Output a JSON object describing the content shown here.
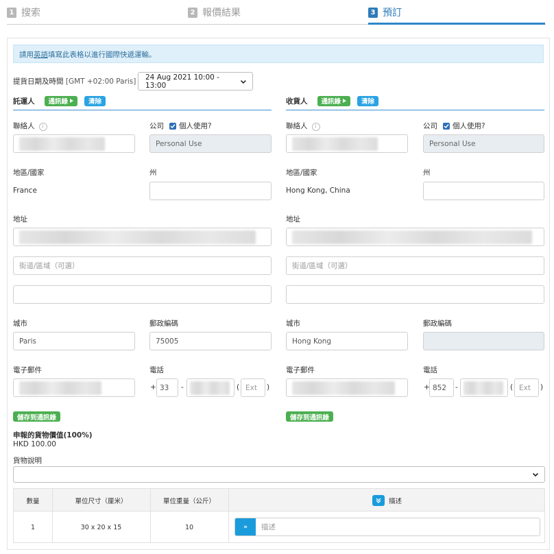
{
  "steps": [
    {
      "num": "1",
      "label": "搜索"
    },
    {
      "num": "2",
      "label": "報價結果"
    },
    {
      "num": "3",
      "label": "預訂"
    }
  ],
  "notice": {
    "prefix": "請用",
    "link": "英語",
    "suffix": "填寫此表格以進行國際快遞運輸。"
  },
  "pickup": {
    "label": "提貨日期及時間",
    "tz": "[GMT +02:00 Paris]",
    "value": "24 Aug 2021 10:00 - 13:00"
  },
  "shipper": {
    "title": "託運人",
    "address_book": "通訊錄",
    "clear": "清除",
    "contact_label": "聯絡人",
    "company_label": "公司",
    "personal_use_label": "個人使用?",
    "company_value": "Personal Use",
    "region_label": "地區/國家",
    "region_value": "France",
    "state_label": "州",
    "address_label": "地址",
    "street_placeholder": "街道/區域（可選）",
    "city_label": "城市",
    "city_value": "Paris",
    "postal_label": "郵政編碼",
    "postal_value": "75005",
    "email_label": "電子郵件",
    "phone_label": "電話",
    "phone_plus": "+",
    "phone_code": "33",
    "phone_dash": "-",
    "ext_open": "(",
    "ext_placeholder": "Ext",
    "ext_close": ")",
    "save_contact": "儲存到通訊錄"
  },
  "consignee": {
    "title": "收貨人",
    "address_book": "通訊錄",
    "clear": "清除",
    "contact_label": "聯絡人",
    "company_label": "公司",
    "personal_use_label": "個人使用?",
    "company_value": "Personal Use",
    "region_label": "地區/國家",
    "region_value": "Hong Kong, China",
    "state_label": "州",
    "address_label": "地址",
    "street_placeholder": "街道/區域（可選）",
    "city_label": "城市",
    "city_value": "Hong Kong",
    "postal_label": "郵政編碼",
    "postal_value": "",
    "email_label": "電子郵件",
    "phone_label": "電話",
    "phone_plus": "+",
    "phone_code": "852",
    "phone_dash": "-",
    "ext_open": "(",
    "ext_placeholder": "Ext",
    "ext_close": ")",
    "save_contact": "儲存到通訊錄"
  },
  "declared": {
    "label": "申報的貨物價值(100%)",
    "value": "HKD 100.00"
  },
  "goods": {
    "label": "貨物說明",
    "value": ""
  },
  "table": {
    "headers": [
      "數量",
      "單位尺寸（厘米）",
      "單位重量（公斤）",
      "描述"
    ],
    "rows": [
      {
        "qty": "1",
        "dims": "30 x 20 x 15",
        "weight": "10",
        "desc_placeholder": "描述"
      }
    ]
  },
  "colors": {
    "accent": "#2e86c8",
    "green": "#4caf50",
    "blue_badge": "#29a3e3",
    "notice_bg": "#dff0fb"
  }
}
